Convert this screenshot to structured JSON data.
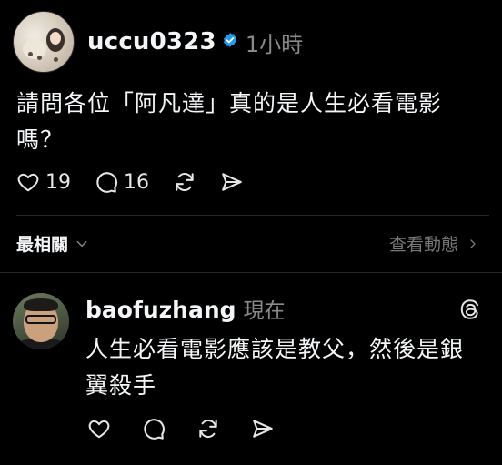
{
  "post": {
    "username": "uccu0323",
    "time": "1小時",
    "text": "請問各位「阿凡達」真的是人生必看電影嗎？",
    "like_count": "19",
    "comment_count": "16",
    "icons": [
      "heart-icon",
      "comment-icon",
      "repost-icon",
      "share-icon"
    ]
  },
  "sort_bar": {
    "label": "最相關",
    "view_activity": "查看動態"
  },
  "reply": {
    "username": "baofuzhang",
    "time": "現在",
    "text": "人生必看電影應該是教父，然後是銀翼殺手",
    "icons": [
      "heart-icon",
      "comment-icon",
      "repost-icon",
      "share-icon"
    ]
  },
  "colors": {
    "background": "#000000",
    "text": "#f3f5f7",
    "muted": "#8a8a8a",
    "verified": "#1d9bf0",
    "divider": "#262626"
  }
}
